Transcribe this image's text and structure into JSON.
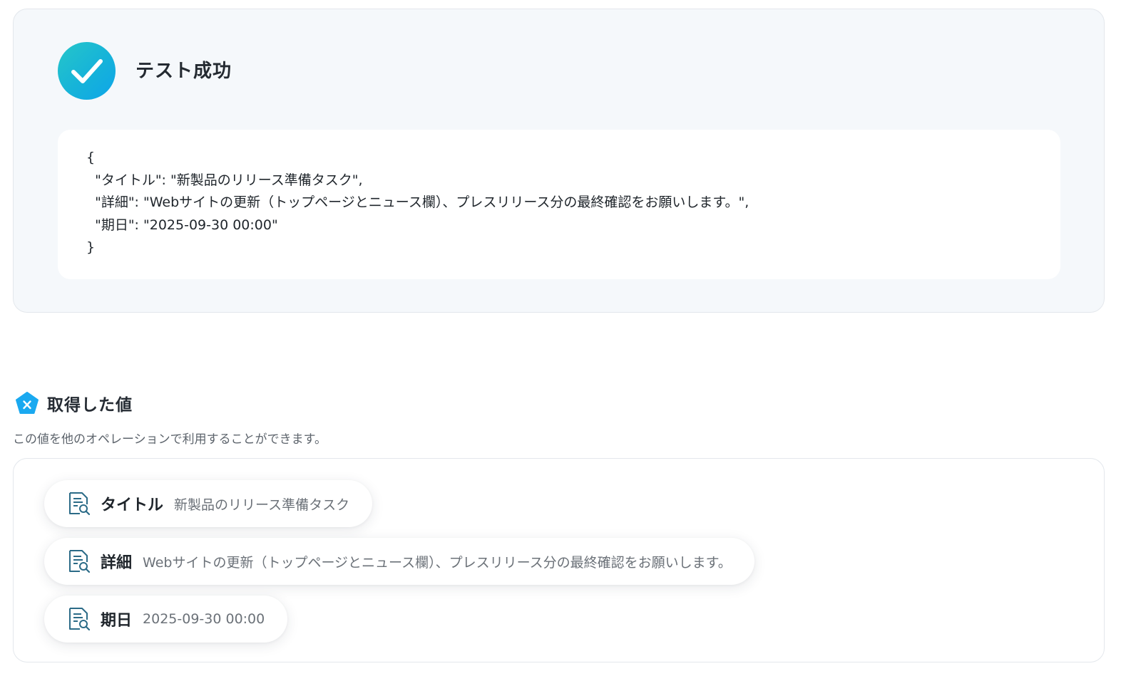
{
  "result": {
    "status_title": "テスト成功",
    "status_icon": "check-circle-icon",
    "json_lines": [
      "{",
      "  \"タイトル\": \"新製品のリリース準備タスク\",",
      "  \"詳細\": \"Webサイトの更新（トップページとニュース欄）、プレスリリース分の最終確認をお願いします。\",",
      "  \"期日\": \"2025-09-30 00:00\"",
      "}"
    ]
  },
  "values": {
    "badge_icon": "variable-x-icon",
    "title": "取得した値",
    "description": "この値を他のオペレーションで利用することができます。",
    "items": [
      {
        "icon": "document-search-icon",
        "key": "タイトル",
        "value": "新製品のリリース準備タスク"
      },
      {
        "icon": "document-search-icon",
        "key": "詳細",
        "value": "Webサイトの更新（トップページとニュース欄）、プレスリリース分の最終確認をお願いします。"
      },
      {
        "icon": "document-search-icon",
        "key": "期日",
        "value": "2025-09-30 00:00"
      }
    ]
  },
  "colors": {
    "panel_background": "#f5f8fb",
    "success_gradient_start": "#26c6c9",
    "success_gradient_end": "#0ea5e9",
    "badge_blue": "#1aa9f0",
    "icon_teal": "#2b6b87"
  }
}
